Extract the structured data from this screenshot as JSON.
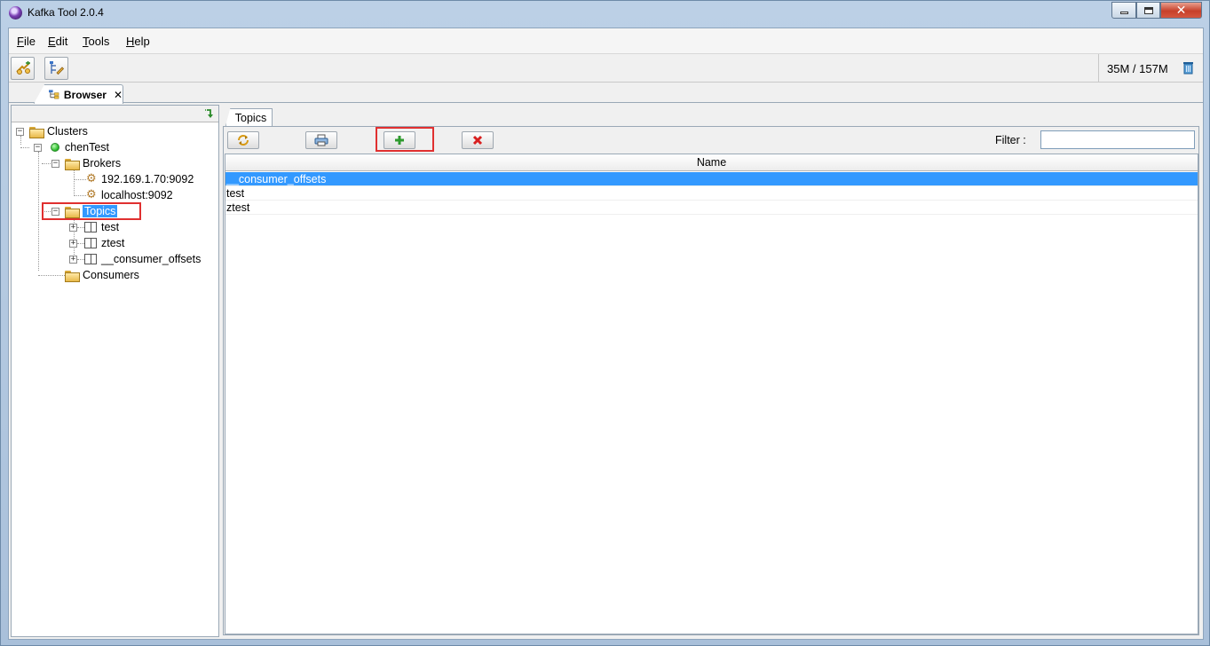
{
  "window": {
    "title": "Kafka Tool  2.0.4"
  },
  "menu": {
    "items": [
      {
        "key": "F",
        "rest": "ile"
      },
      {
        "key": "E",
        "rest": "dit"
      },
      {
        "key": "T",
        "rest": "ools"
      },
      {
        "key": "H",
        "rest": "elp"
      }
    ]
  },
  "toolbar": {
    "memory": "35M / 157M"
  },
  "browser_tab": {
    "label": "Browser",
    "close": "✕"
  },
  "tree": {
    "clusters": "Clusters",
    "cluster_name": "chenTest",
    "brokers": "Brokers",
    "broker_items": [
      "192.169.1.70:9092",
      "localhost:9092"
    ],
    "topics": "Topics",
    "topic_items": [
      "test",
      "ztest",
      "__consumer_offsets"
    ],
    "consumers": "Consumers"
  },
  "topics_panel": {
    "tab_label": "Topics",
    "filter_label": "Filter :",
    "filter_value": "",
    "column_name": "Name",
    "rows": [
      "__consumer_offsets",
      "test",
      "ztest"
    ],
    "selected_index": 0
  },
  "colors": {
    "selection": "#3399ff",
    "highlight_box": "#e03030"
  }
}
